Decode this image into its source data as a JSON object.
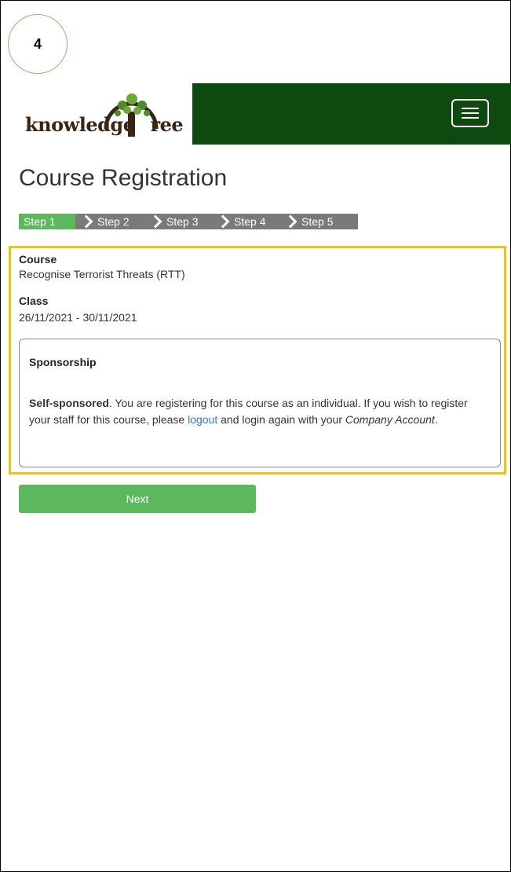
{
  "annotation": {
    "step_number": "4"
  },
  "brand": {
    "logo_text_left": "knowledge",
    "logo_text_right": "ree",
    "header_color": "#0c4a10",
    "accent_green": "#5cb85c",
    "highlight_color": "#f4c20d"
  },
  "header": {
    "menu_icon": "hamburger-icon"
  },
  "page": {
    "title": "Course Registration"
  },
  "steps": [
    {
      "label": "Step 1",
      "active": true
    },
    {
      "label": "Step 2",
      "active": false
    },
    {
      "label": "Step 3",
      "active": false
    },
    {
      "label": "Step 4",
      "active": false
    },
    {
      "label": "Step 5",
      "active": false
    }
  ],
  "course": {
    "course_label": "Course",
    "course_value": "Recognise Terrorist Threats (RTT)",
    "class_label": "Class",
    "class_value": "26/11/2021 - 30/11/2021"
  },
  "sponsorship": {
    "title": "Sponsorship",
    "bold_lead": "Self-sponsored",
    "text_1": ". You are registering for this course as an individual. If you wish to register your staff for this course, please ",
    "link": "logout",
    "text_2": " and login again with your ",
    "italic": "Company Account",
    "text_3": "."
  },
  "actions": {
    "next_label": "Next"
  }
}
